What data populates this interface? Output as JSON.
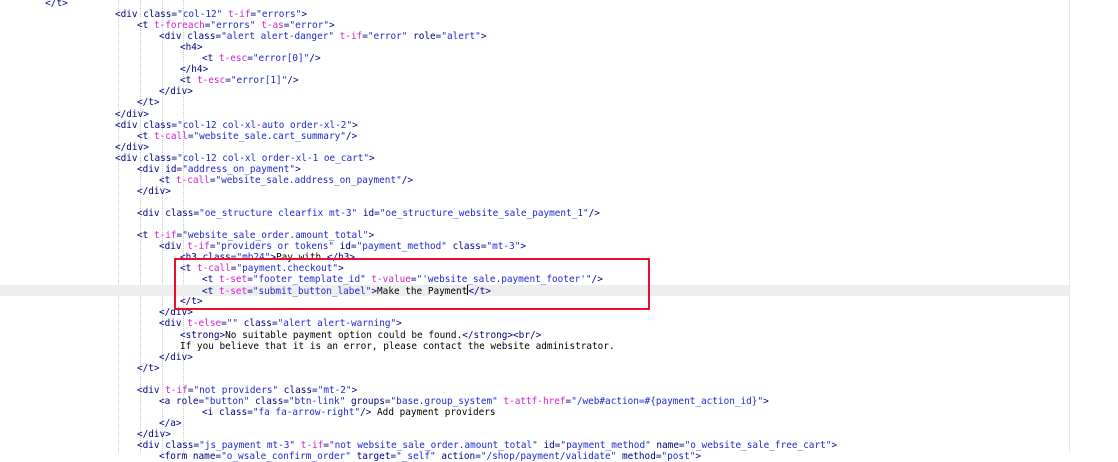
{
  "editor": {
    "lines": [
      {
        "text": "        </t>",
        "indent": 0
      },
      {
        "text": "<div class=\"col-12\" t-if=\"errors\">",
        "indent": 115
      },
      {
        "text": "<t t-foreach=\"errors\" t-as=\"error\">",
        "indent": 137
      },
      {
        "text": "<div class=\"alert alert-danger\" t-if=\"error\" role=\"alert\">",
        "indent": 159
      },
      {
        "text": "<h4>",
        "indent": 180
      },
      {
        "text": "<t t-esc=\"error[0]\"/>",
        "indent": 202
      },
      {
        "text": "</h4>",
        "indent": 180
      },
      {
        "text": "<t t-esc=\"error[1]\"/>",
        "indent": 180
      },
      {
        "text": "</div>",
        "indent": 159
      },
      {
        "text": "</t>",
        "indent": 137
      },
      {
        "text": "</div>",
        "indent": 115
      },
      {
        "text": "<div class=\"col-12 col-xl-auto order-xl-2\">",
        "indent": 115
      },
      {
        "text": "<t t-call=\"website_sale.cart_summary\"/>",
        "indent": 137
      },
      {
        "text": "</div>",
        "indent": 115
      },
      {
        "text": "<div class=\"col-12 col-xl order-xl-1 oe_cart\">",
        "indent": 115
      },
      {
        "text": "<div id=\"address_on_payment\">",
        "indent": 137
      },
      {
        "text": "<t t-call=\"website_sale.address_on_payment\"/>",
        "indent": 159
      },
      {
        "text": "</div>",
        "indent": 137
      },
      {
        "text": "",
        "indent": 0
      },
      {
        "text": "<div class=\"oe_structure clearfix mt-3\" id=\"oe_structure_website_sale_payment_1\"/>",
        "indent": 137
      },
      {
        "text": "",
        "indent": 0
      },
      {
        "text": "<t t-if=\"website_sale_order.amount_total\">",
        "indent": 137
      },
      {
        "text": "<div t-if=\"providers or tokens\" id=\"payment_method\" class=\"mt-3\">",
        "indent": 159
      },
      {
        "text": "<h3 class=\"mb24\">Pay with </h3>",
        "indent": 180
      },
      {
        "text": "<t t-call=\"payment.checkout\">",
        "indent": 180
      },
      {
        "text": "<t t-set=\"footer_template_id\" t-value=\"'website_sale.payment_footer'\"/>",
        "indent": 202
      },
      {
        "text": "<t t-set=\"submit_button_label\">Make the Payment</t>",
        "indent": 202
      },
      {
        "text": "</t>",
        "indent": 180
      },
      {
        "text": "</div>",
        "indent": 159
      },
      {
        "text": "<div t-else=\"\" class=\"alert alert-warning\">",
        "indent": 159
      },
      {
        "text": "<strong>No suitable payment option could be found.</strong><br/>",
        "indent": 180
      },
      {
        "text": "If you believe that it is an error, please contact the website administrator.",
        "indent": 180
      },
      {
        "text": "</div>",
        "indent": 159
      },
      {
        "text": "</t>",
        "indent": 137
      },
      {
        "text": "",
        "indent": 0
      },
      {
        "text": "<div t-if=\"not providers\" class=\"mt-2\">",
        "indent": 137
      },
      {
        "text": "<a role=\"button\" class=\"btn-link\" groups=\"base.group_system\" t-attf-href=\"/web#action=#{payment_action_id}\">",
        "indent": 159
      },
      {
        "text": "<i class=\"fa fa-arrow-right\"/> Add payment providers",
        "indent": 202
      },
      {
        "text": "</a>",
        "indent": 159
      },
      {
        "text": "</div>",
        "indent": 137
      },
      {
        "text": "<div class=\"js_payment mt-3\" t-if=\"not website_sale_order.amount_total\" id=\"payment_method\" name=\"o_website_sale_free_cart\">",
        "indent": 137
      },
      {
        "text": "<form name=\"o_wsale_confirm_order\" target=\"_self\" action=\"/shop/payment/validate\" method=\"post\">",
        "indent": 159
      }
    ],
    "active_line_index": 26,
    "colors": {
      "tag": "#000080",
      "attribute": "#d11fd1",
      "value": "#1b2bd1",
      "text": "#000000",
      "highlight_border": "#e8112d",
      "active_line_bg": "#eeeeee"
    }
  }
}
